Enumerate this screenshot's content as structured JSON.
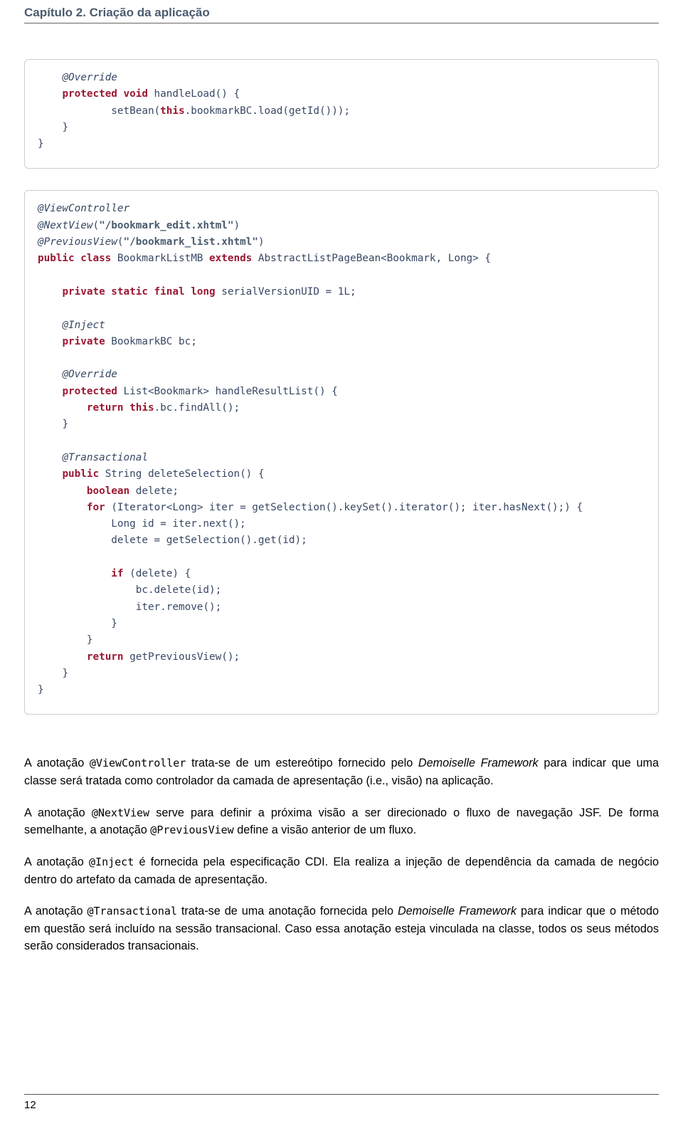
{
  "header": {
    "chapter": "Capítulo 2. Criação da aplicação"
  },
  "code1": {
    "l1_ann": "@Override",
    "l2_kw": "protected void",
    "l2_rest": " handleLoad() {",
    "l3_a": "            setBean(",
    "l3_kw": "this",
    "l3_b": ".bookmarkBC.load(getId()));",
    "l4": "    }",
    "l5": "}"
  },
  "code2": {
    "a1": "@ViewController",
    "a2a": "@NextView",
    "a2b": "(",
    "a2str": "\"/bookmark_edit.xhtml\"",
    "a2c": ")",
    "a3a": "@PreviousView",
    "a3b": "(",
    "a3str": "\"/bookmark_list.xhtml\"",
    "a3c": ")",
    "cls_kw": "public class",
    "cls_rest": " BookmarkListMB ",
    "cls_kw2": "extends",
    "cls_rest2": " AbstractListPageBean<Bookmark, Long> {",
    "f1_kw": "private static final long",
    "f1_rest": " serialVersionUID = 1L;",
    "inj": "@Inject",
    "f2_kw": "private",
    "f2_rest": " BookmarkBC bc;",
    "ovr": "@Override",
    "m1_kw": "protected",
    "m1_rest": " List<Bookmark> handleResultList() {",
    "m1b_kw": "return this",
    "m1b_rest": ".bc.findAll();",
    "cb": "    }",
    "trans": "@Transactional",
    "m2_kw": "public",
    "m2_rest": " String deleteSelection() {",
    "m2a_kw": "boolean",
    "m2a_rest": " delete;",
    "m2b_kw": "for",
    "m2b_rest": " (Iterator<Long> iter = getSelection().keySet().iterator(); iter.hasNext();) {",
    "m2c": "            Long id = iter.next();",
    "m2d": "            delete = getSelection().get(id);",
    "m2e_kw": "if",
    "m2e_rest": " (delete) {",
    "m2f": "                bc.delete(id);",
    "m2g": "                iter.remove();",
    "m2h": "            }",
    "m2i": "        }",
    "m2j_kw": "return",
    "m2j_rest": " getPreviousView();",
    "m2k": "    }",
    "end": "}"
  },
  "paragraphs": {
    "p1a": "A anotação ",
    "p1code": "@ViewController",
    "p1b": " trata-se de um estereótipo fornecido pelo ",
    "p1em": "Demoiselle Framework",
    "p1c": " para indicar que uma classe será tratada como controlador da camada de apresentação (i.e., visão) na aplicação.",
    "p2a": "A anotação ",
    "p2code": "@NextView",
    "p2b": " serve para definir a próxima visão a ser direcionado o fluxo de navegação JSF. De forma semelhante, a anotação ",
    "p2code2": "@PreviousView",
    "p2c": " define a visão anterior de um fluxo.",
    "p3a": "A anotação ",
    "p3code": "@Inject",
    "p3b": " é fornecida pela especificação CDI. Ela realiza a injeção de dependência da camada de negócio dentro do artefato da camada de apresentação.",
    "p4a": "A anotação ",
    "p4code": "@Transactional",
    "p4b": " trata-se de uma anotação fornecida pelo ",
    "p4em": "Demoiselle Framework",
    "p4c": " para indicar que o método em questão será incluído na sessão transacional. Caso essa anotação esteja vinculada na classe, todos os seus métodos serão considerados transacionais."
  },
  "footer": {
    "page": "12"
  }
}
